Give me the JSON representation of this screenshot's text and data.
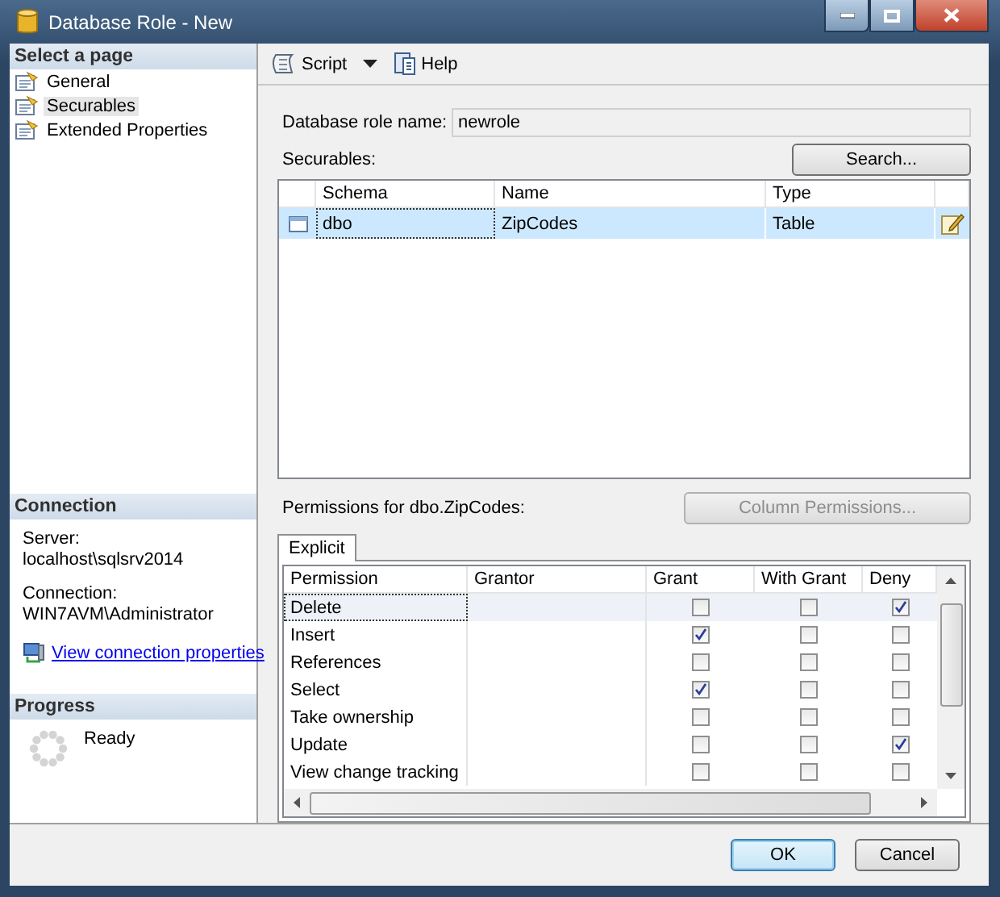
{
  "window": {
    "title": "Database Role - New"
  },
  "sidebar": {
    "header": "Select a page",
    "items": [
      {
        "label": "General",
        "selected": false
      },
      {
        "label": "Securables",
        "selected": true
      },
      {
        "label": "Extended Properties",
        "selected": false
      }
    ]
  },
  "toolbar": [
    {
      "label": "Script",
      "kind": "dropdown"
    },
    {
      "label": "Help",
      "kind": "button"
    }
  ],
  "role_name": {
    "label": "Database role name:",
    "value": "newrole"
  },
  "securables": {
    "label": "Securables:",
    "search_button": "Search...",
    "columns": [
      "Schema",
      "Name",
      "Type"
    ],
    "rows": [
      {
        "schema": "dbo",
        "name": "ZipCodes",
        "type": "Table",
        "selected": true
      }
    ]
  },
  "permissions": {
    "label": "Permissions for dbo.ZipCodes:",
    "column_permissions_button": {
      "label": "Column Permissions...",
      "disabled": true
    },
    "tabs": [
      {
        "label": "Explicit",
        "selected": true
      }
    ],
    "columns": [
      "Permission",
      "Grantor",
      "Grant",
      "With Grant",
      "Deny"
    ],
    "rows": [
      {
        "permission": "Delete",
        "grant": false,
        "with_grant": false,
        "deny": true,
        "selected": true
      },
      {
        "permission": "Insert",
        "grant": true,
        "with_grant": false,
        "deny": false,
        "selected": false
      },
      {
        "permission": "References",
        "grant": false,
        "with_grant": false,
        "deny": false,
        "selected": false
      },
      {
        "permission": "Select",
        "grant": true,
        "with_grant": false,
        "deny": false,
        "selected": false
      },
      {
        "permission": "Take ownership",
        "grant": false,
        "with_grant": false,
        "deny": false,
        "selected": false
      },
      {
        "permission": "Update",
        "grant": false,
        "with_grant": false,
        "deny": true,
        "selected": false
      },
      {
        "permission": "View change tracking",
        "grant": false,
        "with_grant": false,
        "deny": false,
        "selected": false
      }
    ]
  },
  "connection": {
    "header": "Connection",
    "server_label": "Server:",
    "server": "localhost\\sqlsrv2014",
    "connection_label": "Connection:",
    "connection": "WIN7AVM\\Administrator",
    "link": "View connection properties"
  },
  "progress": {
    "header": "Progress",
    "status": "Ready"
  },
  "buttons": [
    {
      "label": "OK",
      "default": true
    },
    {
      "label": "Cancel",
      "default": false
    }
  ]
}
